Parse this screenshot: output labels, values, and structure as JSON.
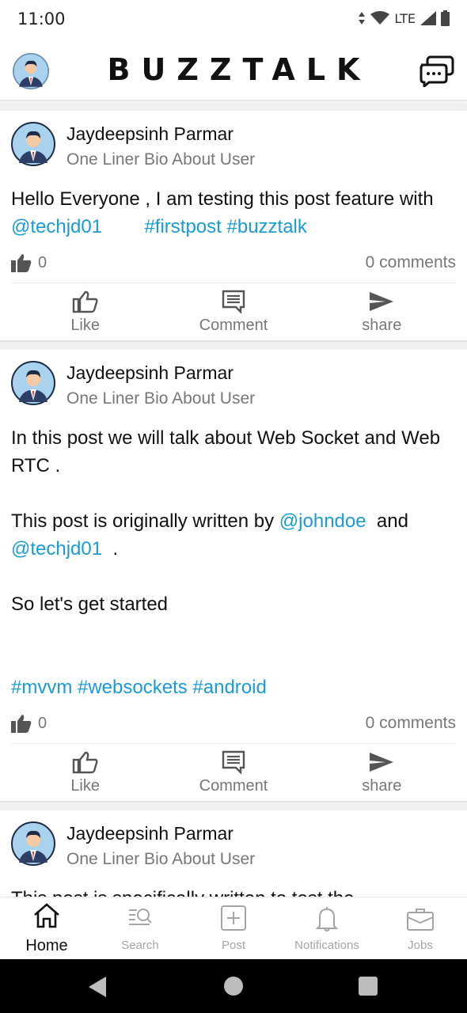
{
  "status_bar": {
    "time": "11:00",
    "network": "LTE"
  },
  "app_bar": {
    "title": "BUZZTALK"
  },
  "posts": [
    {
      "author": "Jaydeepsinh Parmar",
      "bio": "One Liner Bio About User",
      "body": [
        {
          "t": "Hello Everyone , I am testing this post feature with ",
          "k": "text"
        },
        {
          "t": "@techjd01",
          "k": "mention"
        },
        {
          "t": "        ",
          "k": "text"
        },
        {
          "t": "#firstpost #buzztalk",
          "k": "hashtag"
        }
      ],
      "likes": "0",
      "comments": "0 comments"
    },
    {
      "author": "Jaydeepsinh Parmar",
      "bio": "One Liner Bio About User",
      "body": [
        {
          "t": "In this post we will talk about Web Socket and Web RTC .\n\nThis post is originally written by ",
          "k": "text"
        },
        {
          "t": "@johndoe",
          "k": "mention"
        },
        {
          "t": "  and\n",
          "k": "text"
        },
        {
          "t": "@techjd01",
          "k": "mention"
        },
        {
          "t": "  .\n\nSo let's get started\n\n\n",
          "k": "text"
        },
        {
          "t": "#mvvm #websockets #android",
          "k": "hashtag"
        }
      ],
      "likes": "0",
      "comments": "0 comments"
    },
    {
      "author": "Jaydeepsinh Parmar",
      "bio": "One Liner Bio About User",
      "body": [
        {
          "t": "This post is specifically written to test the",
          "k": "text"
        }
      ],
      "likes": "",
      "comments": ""
    }
  ],
  "actions": {
    "like": "Like",
    "comment": "Comment",
    "share": "share"
  },
  "bottom_nav": [
    {
      "label": "Home",
      "icon": "home-icon",
      "active": true
    },
    {
      "label": "Search",
      "icon": "search-icon",
      "active": false
    },
    {
      "label": "Post",
      "icon": "add-post-icon",
      "active": false
    },
    {
      "label": "Notifications",
      "icon": "bell-icon",
      "active": false
    },
    {
      "label": "Jobs",
      "icon": "briefcase-icon",
      "active": false
    }
  ],
  "colors": {
    "link": "#1a9ad6",
    "muted": "#777777",
    "active_nav": "#111111",
    "inactive_nav": "#a5a5a5"
  }
}
